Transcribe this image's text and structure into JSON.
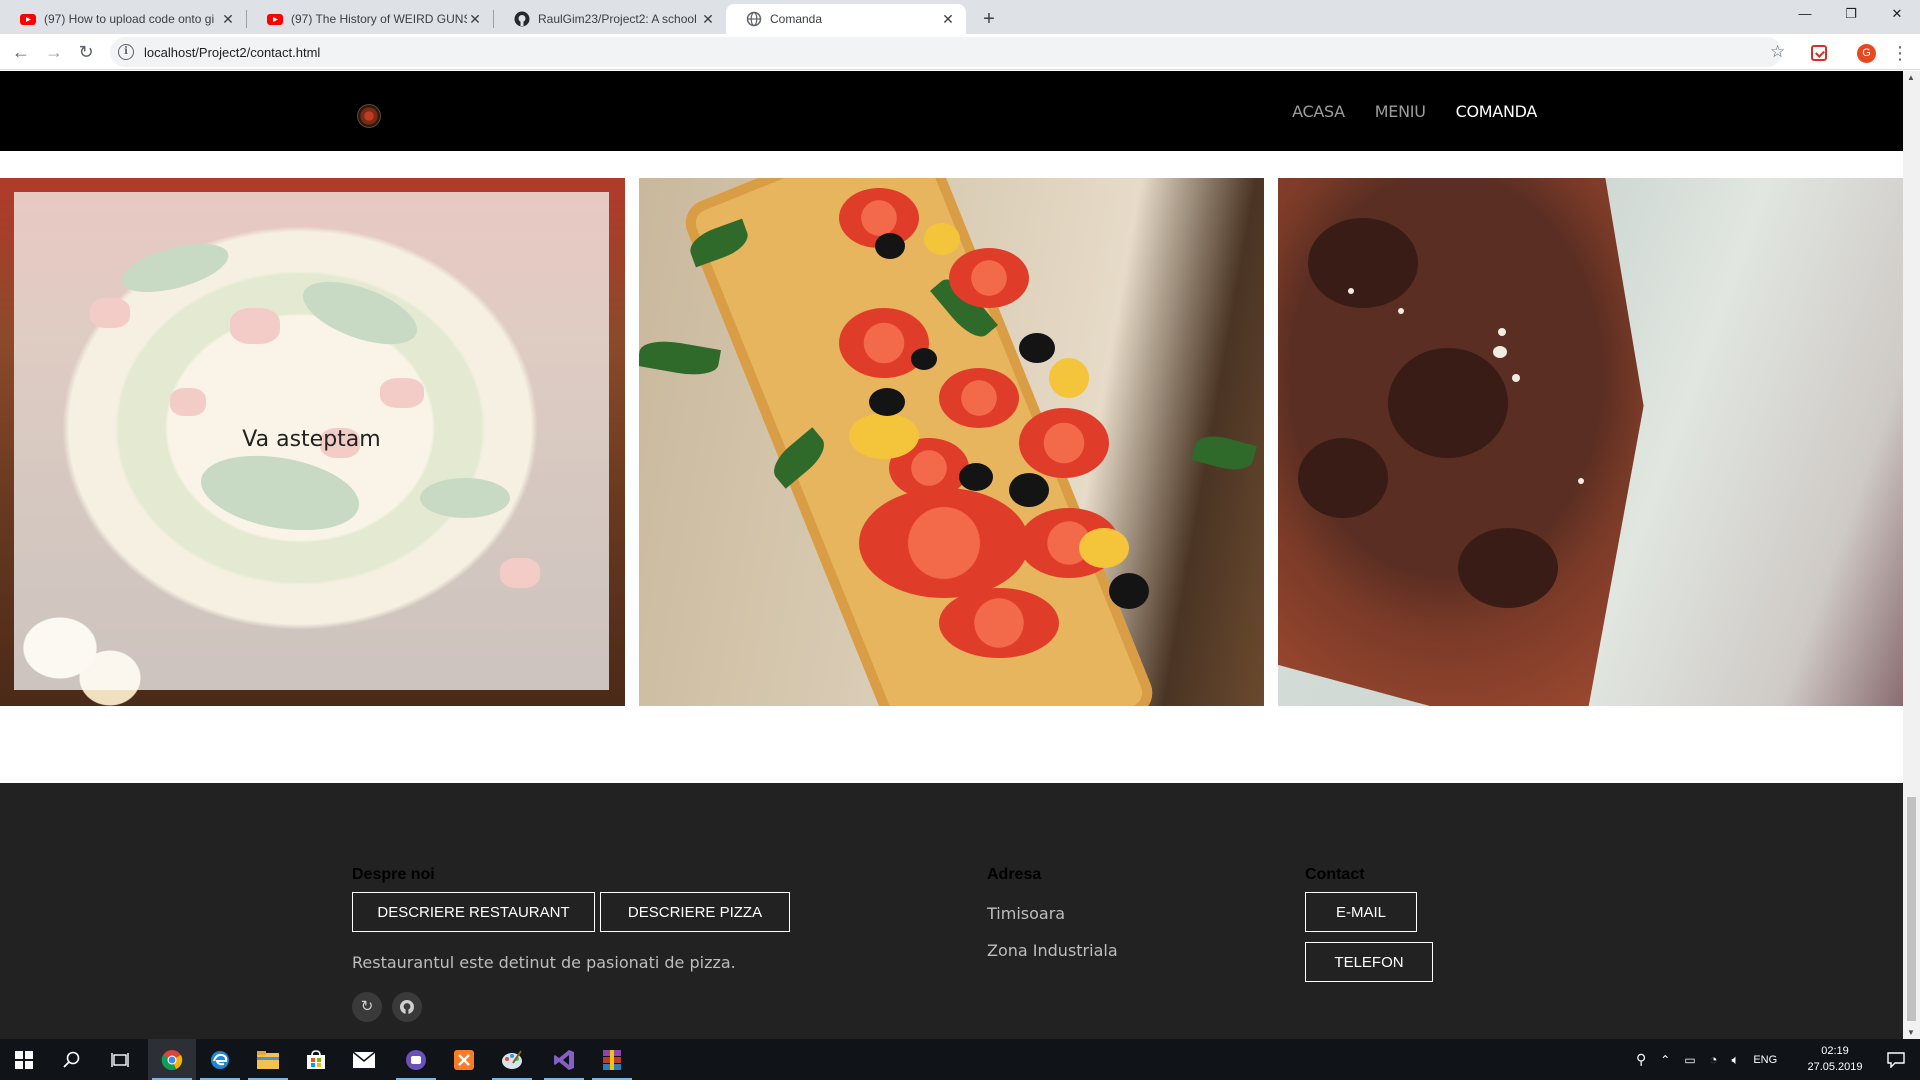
{
  "browser": {
    "tabs": [
      {
        "title": "(97) How to upload code onto gi",
        "favicon": "youtube-icon"
      },
      {
        "title": "(97) The History of WEIRD GUNS",
        "favicon": "youtube-icon"
      },
      {
        "title": "RaulGim23/Project2: A school pr",
        "favicon": "github-icon"
      },
      {
        "title": "Comanda",
        "favicon": "globe-icon"
      }
    ],
    "url": "localhost/Project2/contact.html",
    "avatar_letter": "G"
  },
  "site": {
    "nav": {
      "links": [
        {
          "label": "ACASA"
        },
        {
          "label": "MENIU"
        },
        {
          "label": "COMANDA"
        }
      ]
    },
    "gallery": {
      "overlay_text": "Va asteptam"
    },
    "footer": {
      "about": {
        "heading": "Despre noi",
        "btn_restaurant": "DESCRIERE RESTAURANT",
        "btn_pizza": "DESCRIERE PIZZA",
        "text": "Restaurantul este detinut de pasionati de pizza."
      },
      "address": {
        "heading": "Adresa",
        "line1": "Timisoara",
        "line2": "Zona Industriala"
      },
      "contact": {
        "heading": "Contact",
        "btn_email": "E-MAIL",
        "btn_phone": "TELEFON"
      }
    }
  },
  "taskbar": {
    "lang": "ENG",
    "time": "02:19",
    "date": "27.05.2019"
  },
  "colors": {
    "nav_bg": "#000000",
    "footer_bg": "#222222",
    "nav_active": "#ffffff",
    "nav_inactive": "#9d9d9d"
  }
}
